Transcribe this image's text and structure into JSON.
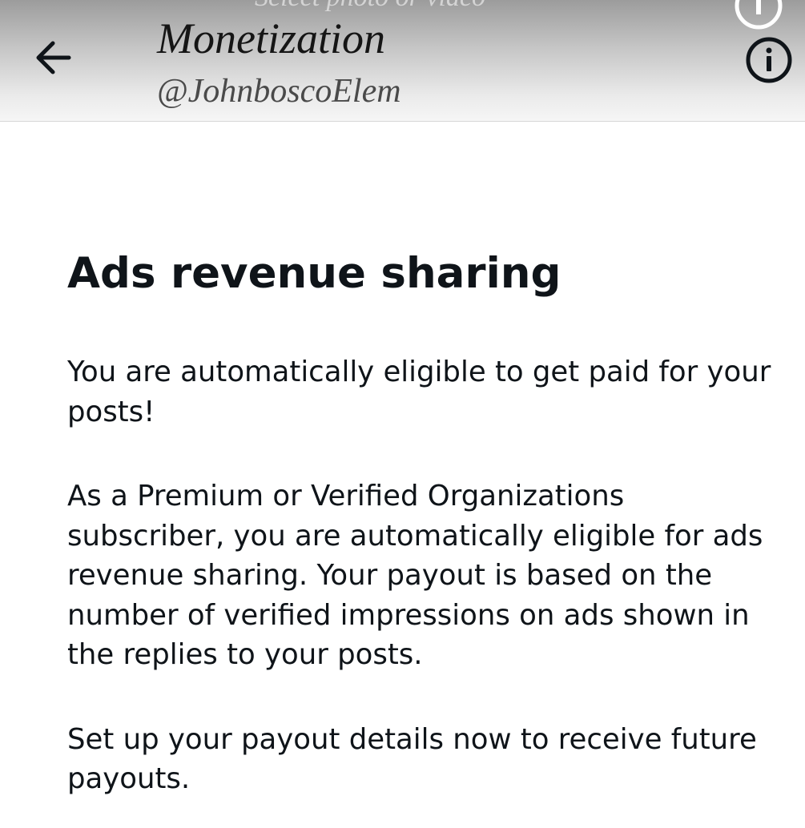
{
  "header": {
    "behind_text": "Select photo or video",
    "title": "Monetization",
    "handle": "@JohnboscoElem"
  },
  "icons": {
    "back": "arrow-left-icon",
    "info": "info-icon",
    "close": "close-icon"
  },
  "main": {
    "heading": "Ads revenue sharing",
    "paragraphs": [
      "You are automatically eligible to get paid for your posts!",
      "As a Premium or Verified Organizations subscriber, you are automatically eligible for ads revenue sharing. Your payout is based on the number of verified impressions on ads shown in the replies to your posts.",
      "Set up your payout details now to receive future payouts."
    ]
  },
  "colors": {
    "text": "#0f1419",
    "background": "#ffffff"
  }
}
